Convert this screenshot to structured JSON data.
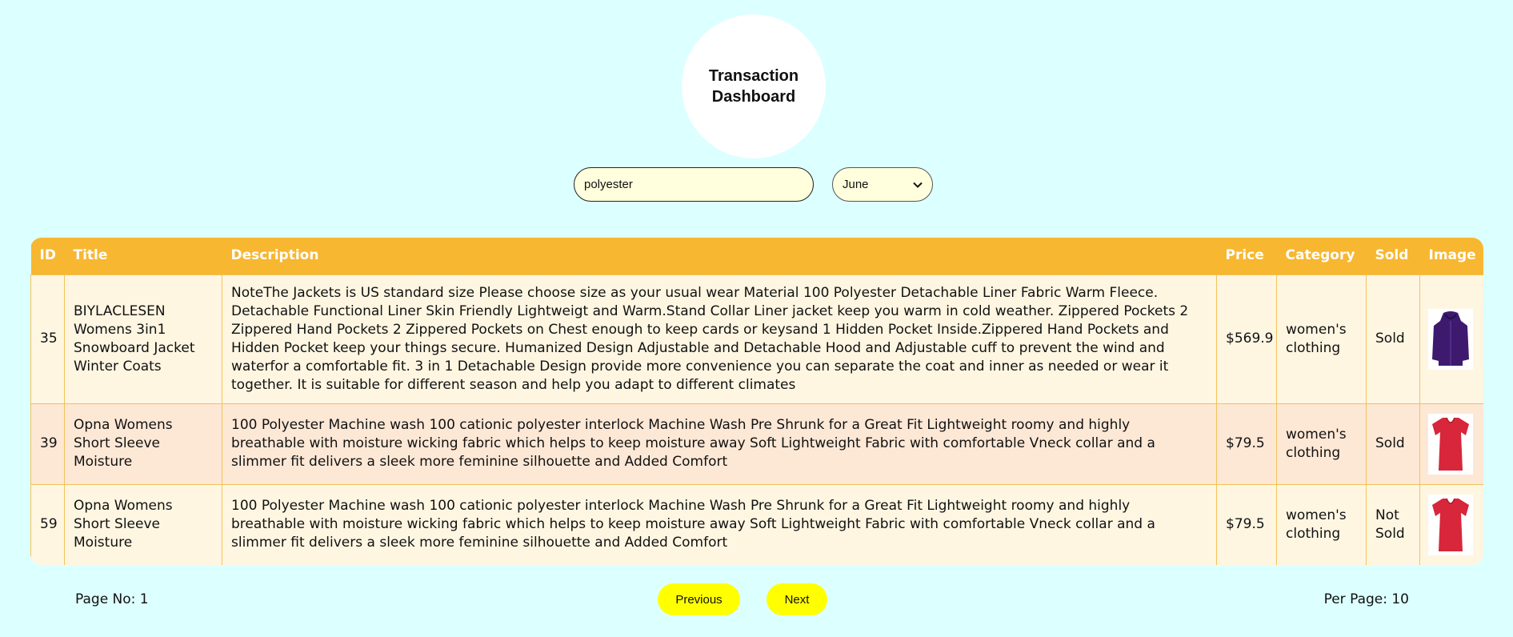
{
  "header": {
    "title": "Transaction Dashboard"
  },
  "search": {
    "value": "polyester",
    "placeholder": ""
  },
  "month_select": {
    "selected": "June"
  },
  "table": {
    "columns": [
      "ID",
      "Title",
      "Description",
      "Price",
      "Category",
      "Sold",
      "Image"
    ],
    "rows": [
      {
        "id": "35",
        "title": "BIYLACLESEN Womens 3in1 Snowboard Jacket Winter Coats",
        "description": "NoteThe Jackets is US standard size Please choose size as your usual wear Material 100 Polyester Detachable Liner Fabric Warm Fleece. Detachable Functional Liner Skin Friendly Lightweigt and Warm.Stand Collar Liner jacket keep you warm in cold weather. Zippered Pockets 2 Zippered Hand Pockets 2 Zippered Pockets on Chest enough to keep cards or keysand 1 Hidden Pocket Inside.Zippered Hand Pockets and Hidden Pocket keep your things secure. Humanized Design Adjustable and Detachable Hood and Adjustable cuff to prevent the wind and waterfor a comfortable fit. 3 in 1 Detachable Design provide more convenience you can separate the coat and inner as needed or wear it together. It is suitable for different season and help you adapt to different climates",
        "price": "$569.9",
        "category": "women's clothing",
        "sold": "Sold",
        "image": "purple-jacket-image",
        "image_color": "#3d1a6e"
      },
      {
        "id": "39",
        "title": "Opna Womens Short Sleeve Moisture",
        "description": "100 Polyester Machine wash 100 cationic polyester interlock Machine Wash Pre Shrunk for a Great Fit Lightweight roomy and highly breathable with moisture wicking fabric which helps to keep moisture away Soft Lightweight Fabric with comfortable Vneck collar and a slimmer fit delivers a sleek more feminine silhouette and Added Comfort",
        "price": "$79.5",
        "category": "women's clothing",
        "sold": "Sold",
        "image": "red-tshirt-image",
        "image_color": "#d8263a"
      },
      {
        "id": "59",
        "title": "Opna Womens Short Sleeve Moisture",
        "description": "100 Polyester Machine wash 100 cationic polyester interlock Machine Wash Pre Shrunk for a Great Fit Lightweight roomy and highly breathable with moisture wicking fabric which helps to keep moisture away Soft Lightweight Fabric with comfortable Vneck collar and a slimmer fit delivers a sleek more feminine silhouette and Added Comfort",
        "price": "$79.5",
        "category": "women's clothing",
        "sold": "Not Sold",
        "image": "red-tshirt-image",
        "image_color": "#d8263a"
      }
    ]
  },
  "footer": {
    "page_no": "Page No: 1",
    "previous_label": "Previous",
    "next_label": "Next",
    "per_page": "Per Page: 10"
  },
  "colors": {
    "background": "#dcffff",
    "header_row": "#f7b731",
    "row_light": "#fff6e2",
    "row_alt": "#fde8d6",
    "button": "#ffff00",
    "input_bg": "#ffffdd"
  }
}
